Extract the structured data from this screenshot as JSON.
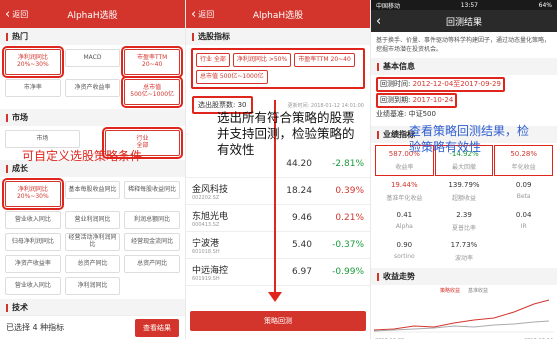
{
  "screen1": {
    "back": "返回",
    "title": "AlphaH选股",
    "section_hot": "热门",
    "hot_chips": [
      {
        "label": "净利润同比\n20%~30%",
        "selected": true
      },
      {
        "label": "MACD",
        "selected": false
      },
      {
        "label": "市盈率TTM\n20~40",
        "selected": true
      },
      {
        "label": "市净率",
        "selected": false
      },
      {
        "label": "净资产收益率",
        "selected": false
      },
      {
        "label": "总市值\n500亿~1000亿",
        "selected": true
      }
    ],
    "section_market": "市场",
    "market_chips": [
      {
        "label": "市场",
        "selected": false
      },
      {
        "label": "行业\n全部",
        "selected": true
      }
    ],
    "section_growth": "成长",
    "growth_chips": [
      {
        "label": "净利润同比\n20%~30%",
        "selected": true
      },
      {
        "label": "基本每股收益同比",
        "selected": false
      },
      {
        "label": "稀释每股收益同比",
        "selected": false
      },
      {
        "label": "营业收入同比",
        "selected": false
      },
      {
        "label": "营业利润同比",
        "selected": false
      },
      {
        "label": "利润总额同比",
        "selected": false
      },
      {
        "label": "归母净利润同比",
        "selected": false
      },
      {
        "label": "经营活动净利润同比",
        "selected": false
      },
      {
        "label": "经营现金流同比",
        "selected": false
      },
      {
        "label": "净资产收益率",
        "selected": false
      },
      {
        "label": "总资产同比",
        "selected": false
      },
      {
        "label": "总资产同比",
        "selected": false
      },
      {
        "label": "营业收入同比",
        "selected": false
      },
      {
        "label": "净利润同比",
        "selected": false
      }
    ],
    "section_tech": "技术",
    "selected_count": "已选择 4 种指标",
    "view_btn": "查看结果",
    "annotation": "可自定义选股策略条件"
  },
  "screen2": {
    "back": "返回",
    "title": "AlphaH选股",
    "section": "选股指标",
    "chips": [
      "行业 全部",
      "净利润同比 >50%",
      "市盈率TTM 20~40",
      "总市值 500亿~1000亿"
    ],
    "count_label": "选出股票数:",
    "count": "30",
    "update": "更新时间: 2018-01-12 14:01:00",
    "stocks": [
      {
        "name": "",
        "code": "",
        "price": "44.20",
        "change": "-2.81%",
        "dir": "down"
      },
      {
        "name": "金风科技",
        "code": "002202.SZ",
        "price": "18.24",
        "change": "0.39%",
        "dir": "up"
      },
      {
        "name": "东旭光电",
        "code": "000413.SZ",
        "price": "9.46",
        "change": "0.21%",
        "dir": "up"
      },
      {
        "name": "宁波港",
        "code": "601018.SH",
        "price": "5.40",
        "change": "-0.37%",
        "dir": "down"
      },
      {
        "name": "中远海控",
        "code": "601919.SH",
        "price": "6.97",
        "change": "-0.99%",
        "dir": "down"
      }
    ],
    "backtest_btn": "策略回测",
    "annotation_lines": [
      "选出所有符合策略的股票",
      "并支持回测，检验策略的",
      "有效性"
    ]
  },
  "screen3": {
    "status_left": "中国移动",
    "status_time": "13:57",
    "status_right": "64%",
    "title": "回测结果",
    "intro": "基于换手、价量、事件驱动等科学构建因子，通过动态量化策略，挖掘市场潜在投资机会。",
    "section_basic": "基本信息",
    "backtest_time_label": "回测时间:",
    "backtest_time": "2012-12-04至2017-09-29",
    "rebalance_label": "回测到期:",
    "rebalance_time": "2017-10-24",
    "benchmark_label": "业绩基准:",
    "benchmark": "中证500",
    "section_perf": "业绩指标",
    "annotation_lines": [
      "查看策略回测结果，检",
      "验策略有效性"
    ],
    "metrics": [
      {
        "v": "587.00%",
        "k": "收益率",
        "color": "#d3352c"
      },
      {
        "v": "-14.92%",
        "k": "最大回撤",
        "color": "#1a9a3a"
      },
      {
        "v": "50.28%",
        "k": "年化收益",
        "color": "#d3352c"
      },
      {
        "v": "19.44%",
        "k": "基准年化收益",
        "color": "#d3352c"
      },
      {
        "v": "139.79%",
        "k": "超额收益",
        "color": "#333"
      },
      {
        "v": "0.09",
        "k": "Beta",
        "color": "#333"
      },
      {
        "v": "0.41",
        "k": "Alpha",
        "color": "#333"
      },
      {
        "v": "2.39",
        "k": "夏普比率",
        "color": "#333"
      },
      {
        "v": "0.04",
        "k": "IR",
        "color": "#333"
      },
      {
        "v": "0.90",
        "k": "sortino",
        "color": "#333"
      },
      {
        "v": "17.73%",
        "k": "波动率",
        "color": "#333"
      },
      {
        "v": "",
        "k": "",
        "color": "#333"
      }
    ],
    "section_trend": "收益走势",
    "legend_a": "策略收益",
    "legend_b": "基准收益",
    "x_start": "2012-12-03",
    "x_end": "2017-10-24"
  }
}
